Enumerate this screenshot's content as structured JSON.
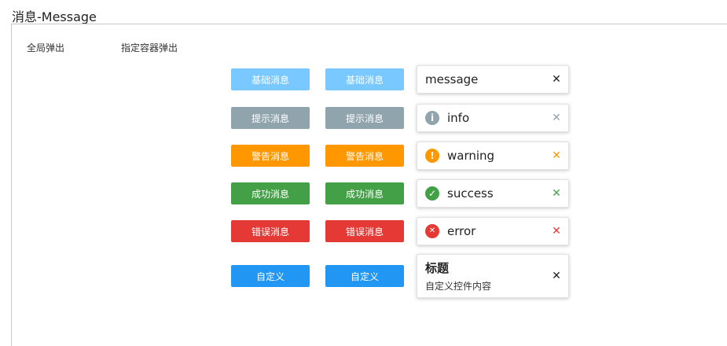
{
  "page": {
    "title": "消息-Message"
  },
  "labels": {
    "global": "全局弹出",
    "container": "指定容器弹出"
  },
  "rows": [
    {
      "label": "基础消息",
      "color": "#79c8ff"
    },
    {
      "label": "提示消息",
      "color": "#90a4ae"
    },
    {
      "label": "警告消息",
      "color": "#ff9800"
    },
    {
      "label": "成功消息",
      "color": "#43a047"
    },
    {
      "label": "错误消息",
      "color": "#e53935"
    },
    {
      "label": "自定义",
      "color": "#2196f3"
    }
  ],
  "messages": {
    "basic": {
      "text": "message",
      "close_color": "#222222"
    },
    "info": {
      "text": "info",
      "icon": "info-icon",
      "icon_glyph": "i",
      "color": "#90a4ae"
    },
    "warning": {
      "text": "warning",
      "icon": "exclamation-icon",
      "icon_glyph": "!",
      "color": "#ff9800"
    },
    "success": {
      "text": "success",
      "icon": "check-icon",
      "icon_glyph": "✓",
      "color": "#43a047"
    },
    "error": {
      "text": "error",
      "icon": "x-icon",
      "icon_glyph": "✕",
      "color": "#e53935"
    },
    "custom": {
      "title": "标题",
      "body": "自定义控件内容",
      "close_color": "#222222"
    }
  },
  "close_glyph": "✕"
}
